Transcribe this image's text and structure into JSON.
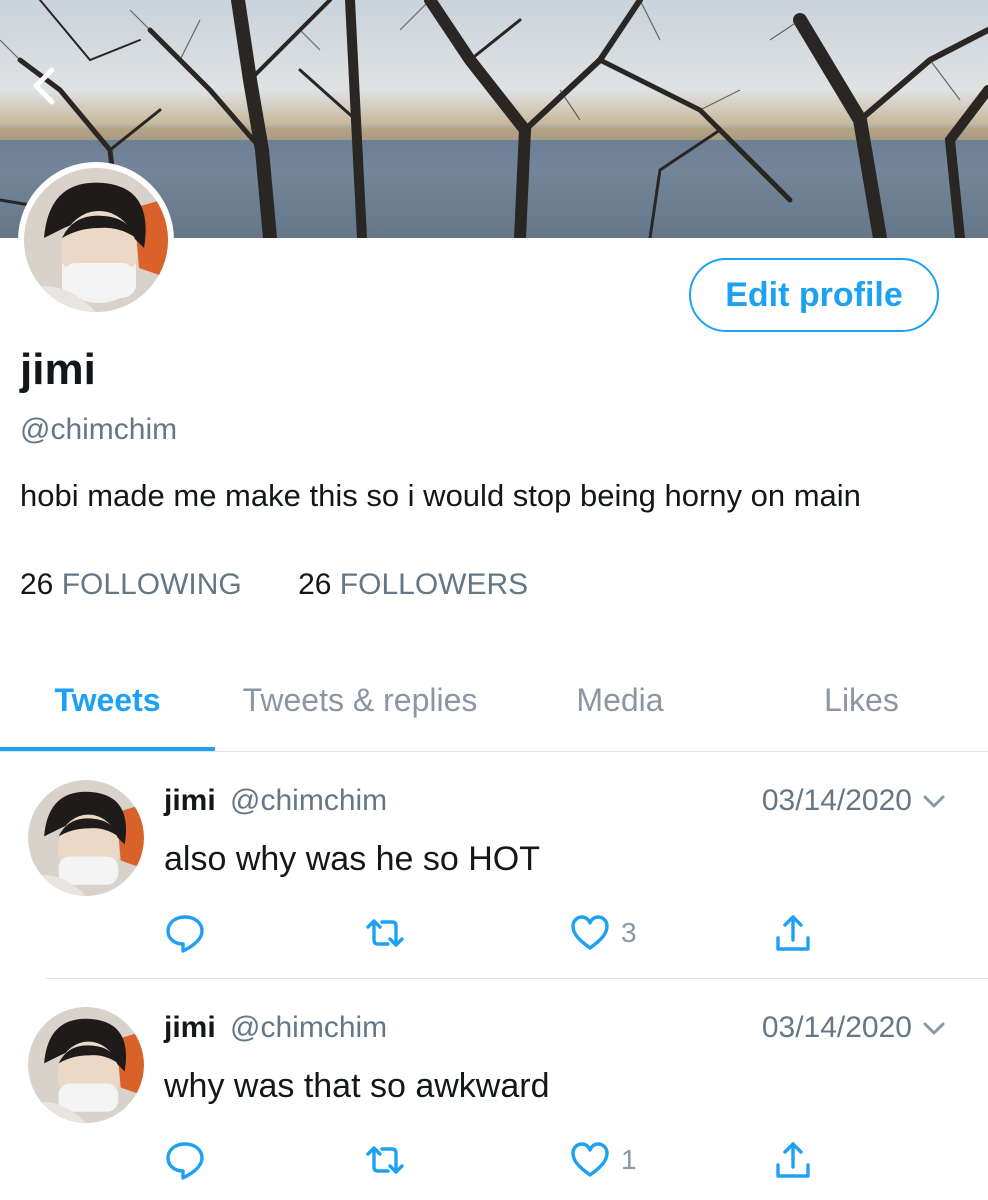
{
  "profile": {
    "display_name": "jimi",
    "handle": "@chimchim",
    "bio": "hobi made me make this so i would stop being horny on main",
    "edit_button_label": "Edit profile",
    "following_count": "26",
    "following_label": "FOLLOWING",
    "followers_count": "26",
    "followers_label": "FOLLOWERS"
  },
  "icons": {
    "back": "chevron-left-icon",
    "reply": "reply-icon",
    "retweet": "retweet-icon",
    "like": "heart-icon",
    "share": "share-icon",
    "menu": "chevron-down-icon"
  },
  "colors": {
    "accent": "#1da1f2",
    "muted": "#657786",
    "text": "#14171a"
  },
  "tabs": [
    {
      "label": "Tweets",
      "active": true
    },
    {
      "label": "Tweets & replies",
      "active": false
    },
    {
      "label": "Media",
      "active": false
    },
    {
      "label": "Likes",
      "active": false
    }
  ],
  "tweets": [
    {
      "name": "jimi",
      "handle": "@chimchim",
      "date": "03/14/2020",
      "text": "also why was he so HOT",
      "like_count": "3"
    },
    {
      "name": "jimi",
      "handle": "@chimchim",
      "date": "03/14/2020",
      "text": "why was that so awkward",
      "like_count": "1"
    }
  ]
}
